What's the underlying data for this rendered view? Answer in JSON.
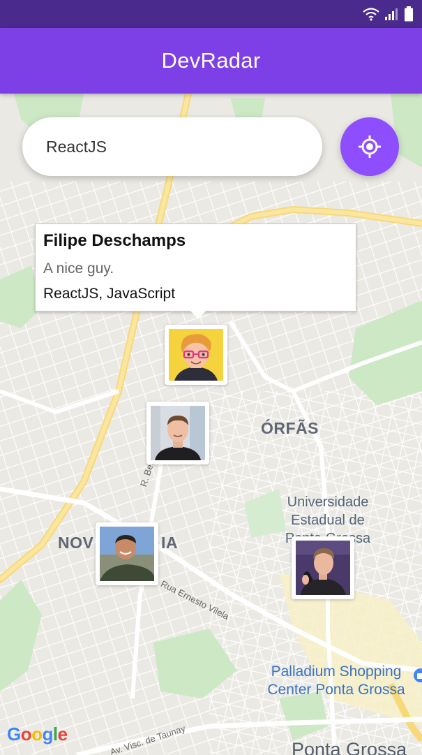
{
  "app": {
    "title": "DevRadar"
  },
  "search": {
    "value": "ReactJS"
  },
  "locate_button": {
    "icon": "crosshair-icon"
  },
  "callout": {
    "name": "Filipe Deschamps",
    "bio": "A nice guy.",
    "techs": "ReactJS, JavaScript"
  },
  "map_labels": {
    "area_orfas": "ÓRFÃS",
    "area_nov": "NOV",
    "area_ia": "IA",
    "university_line1": "Universidade",
    "university_line2": "Estadual de",
    "university_line3": "Ponta Grossa",
    "university_line4": "...",
    "mall_line1": "Palladium Shopping",
    "mall_line2": "Center Ponta Grossa",
    "city": "Ponta Grossa",
    "street_bento": "R. Bento Ribei",
    "street_ernesto": "Rua Ernesto Vilela",
    "street_visc": "Av. Visc. de Taunay"
  },
  "google_logo": [
    "G",
    "o",
    "o",
    "g",
    "l",
    "e"
  ],
  "colors": {
    "primary": "#7d40e7",
    "status_bar": "#4a2a8c",
    "fab": "#8e4dff",
    "google_blue": "#4285f4",
    "google_red": "#ea4335",
    "google_yellow": "#fbbc05",
    "google_green": "#34a853"
  }
}
